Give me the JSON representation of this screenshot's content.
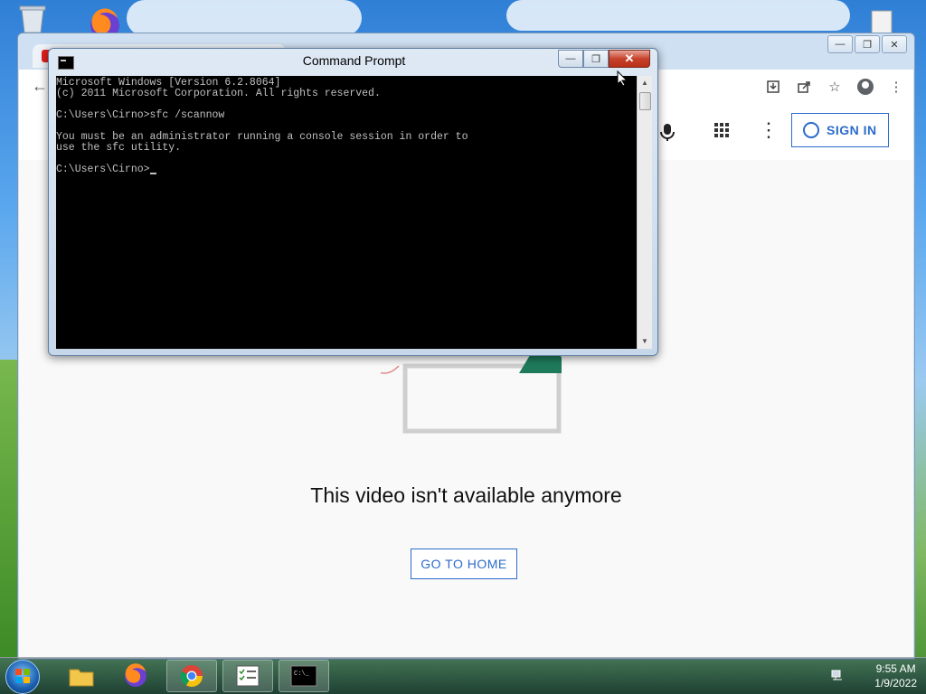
{
  "cmd": {
    "title": "Command Prompt",
    "lines": [
      "Microsoft Windows [Version 6.2.8064]",
      "(c) 2011 Microsoft Corporation. All rights reserved.",
      "",
      "C:\\Users\\Cirno>sfc /scannow",
      "",
      "You must be an administrator running a console session in order to",
      "use the sfc utility.",
      "",
      "C:\\Users\\Cirno>"
    ]
  },
  "youtube": {
    "sign_in": "SIGN IN",
    "message": "This video isn't available anymore",
    "go_home": "GO TO HOME"
  },
  "taskbar": {
    "time": "9:55 AM",
    "date": "1/9/2022"
  },
  "colors": {
    "accent": "#2b6bc9",
    "console_bg": "#000000",
    "console_fg": "#c0c0c0"
  }
}
